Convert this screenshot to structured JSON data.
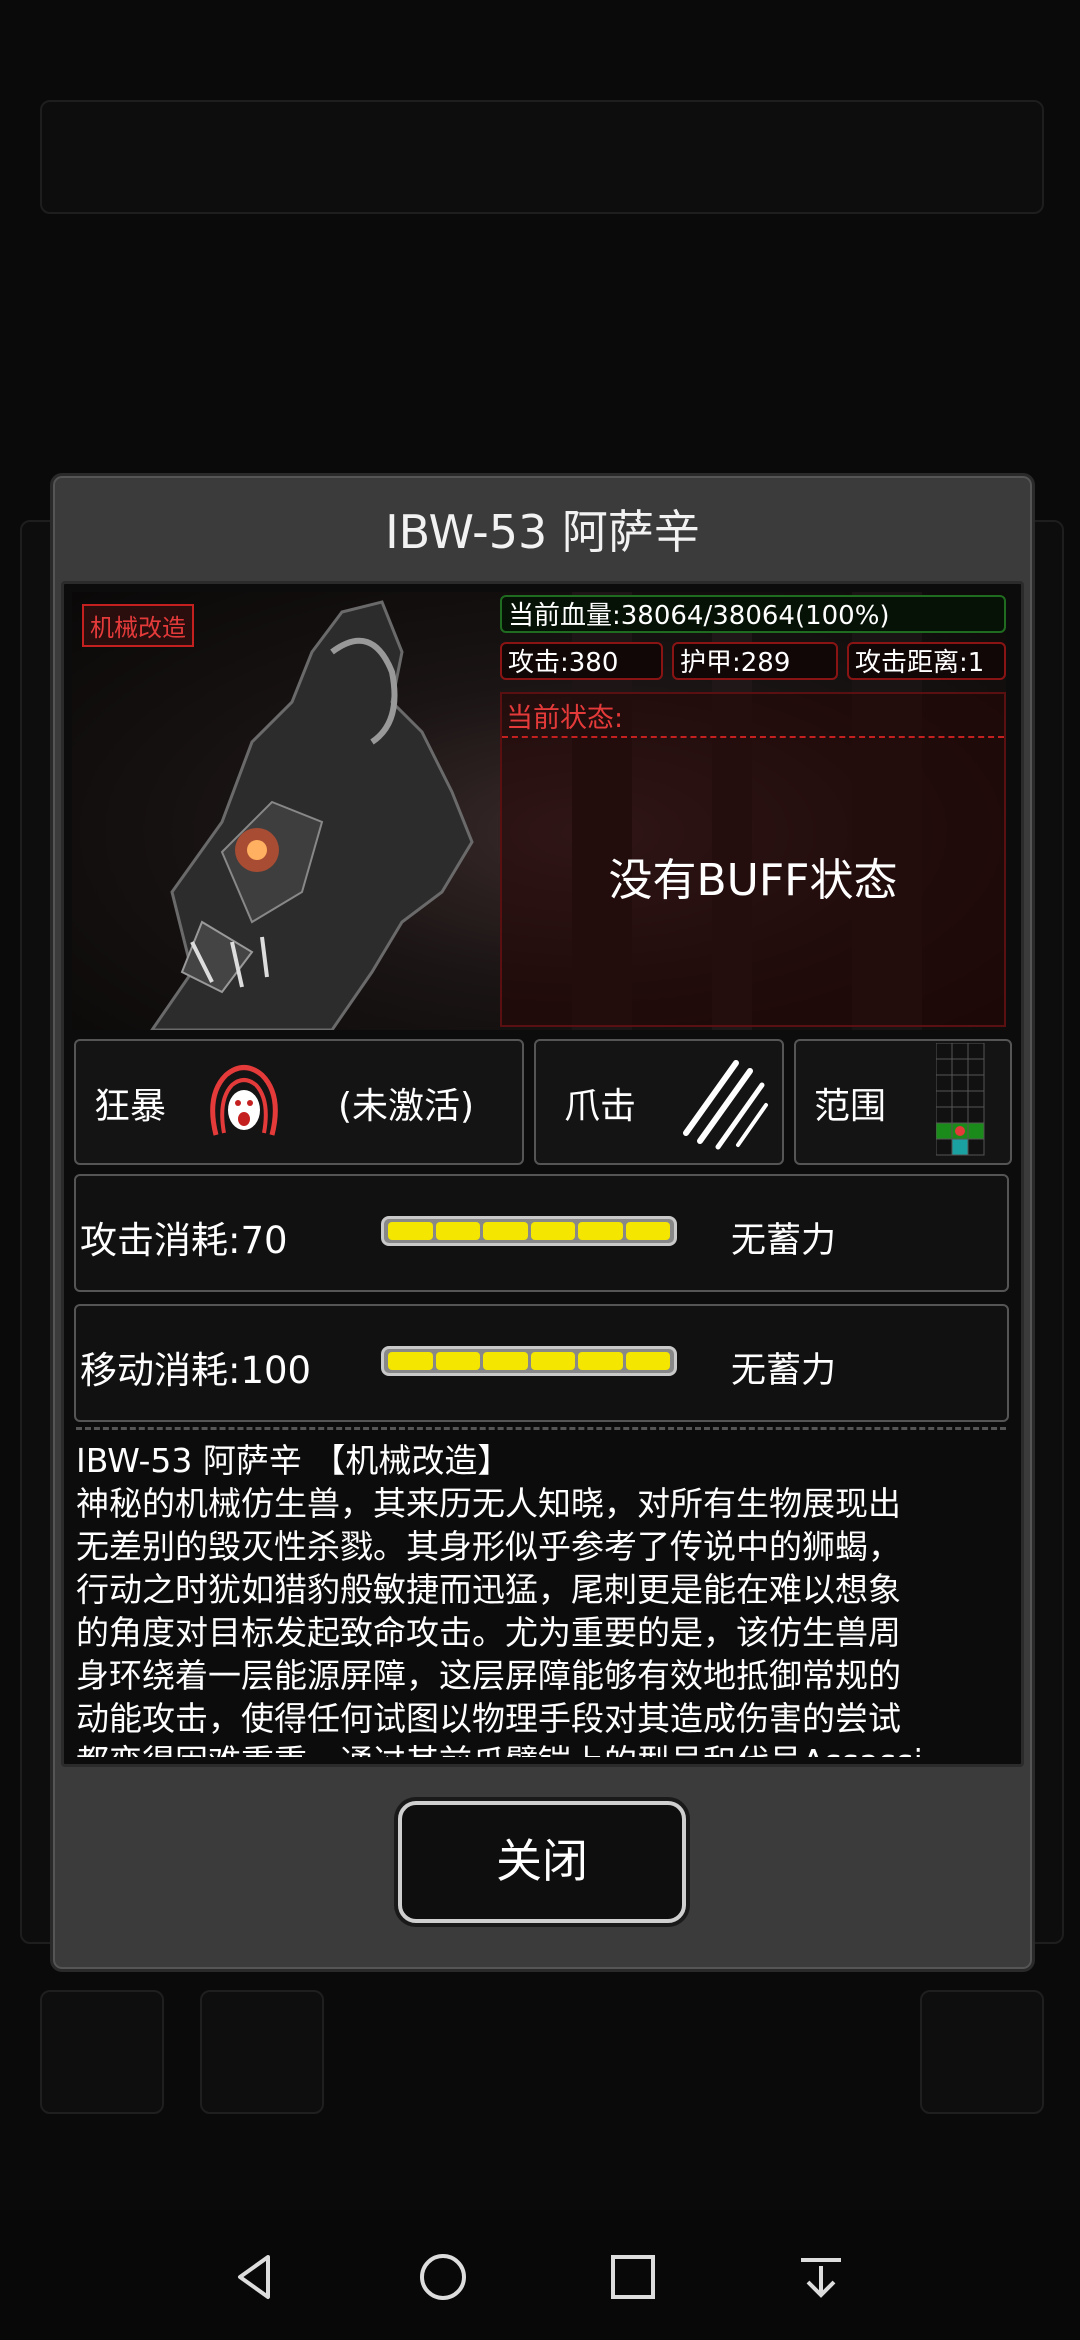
{
  "dialog": {
    "title": "IBW-53 阿萨辛",
    "tag": "机械改造",
    "stats": {
      "hp": "当前血量:38064/38064(100%)",
      "attack": "攻击:380",
      "armor": "护甲:289",
      "range": "攻击距离:1"
    },
    "state_label": "当前状态:",
    "state_value": "没有BUFF状态",
    "skills": {
      "rage_label": "狂暴",
      "rage_status": "(未激活)",
      "claw_label": "爪击",
      "range_label": "范围"
    },
    "costs": [
      {
        "label": "攻击消耗:70",
        "status": "无蓄力",
        "fill": 1.0
      },
      {
        "label": "移动消耗:100",
        "status": "无蓄力",
        "fill": 1.0
      }
    ],
    "description": {
      "heading": "IBW-53 阿萨辛 【机械改造】",
      "lines": [
        "神秘的机械仿生兽，其来历无人知晓，对所有生物展现出",
        "无差别的毁灭性杀戮。其身形似乎参考了传说中的狮蝎，",
        "行动之时犹如猎豹般敏捷而迅猛，尾刺更是能在难以想象",
        "的角度对目标发起致命攻击。尤为重要的是，该仿生兽周",
        "身环绕着一层能源屏障，这层屏障能够有效地抵御常规的",
        "动能攻击，使得任何试图以物理手段对其造成伤害的尝试",
        "都变得困难重重，通过其前爪臂铠上的型号和代号Assassi"
      ]
    },
    "close_label": "关闭"
  },
  "colors": {
    "accent_red": "#e43a3a",
    "bar_yellow": "#f5e600",
    "hp_green": "#1f6b1f"
  },
  "navbar": {
    "icons": [
      "back-icon",
      "home-icon",
      "recents-icon",
      "notification-shade-icon"
    ]
  }
}
